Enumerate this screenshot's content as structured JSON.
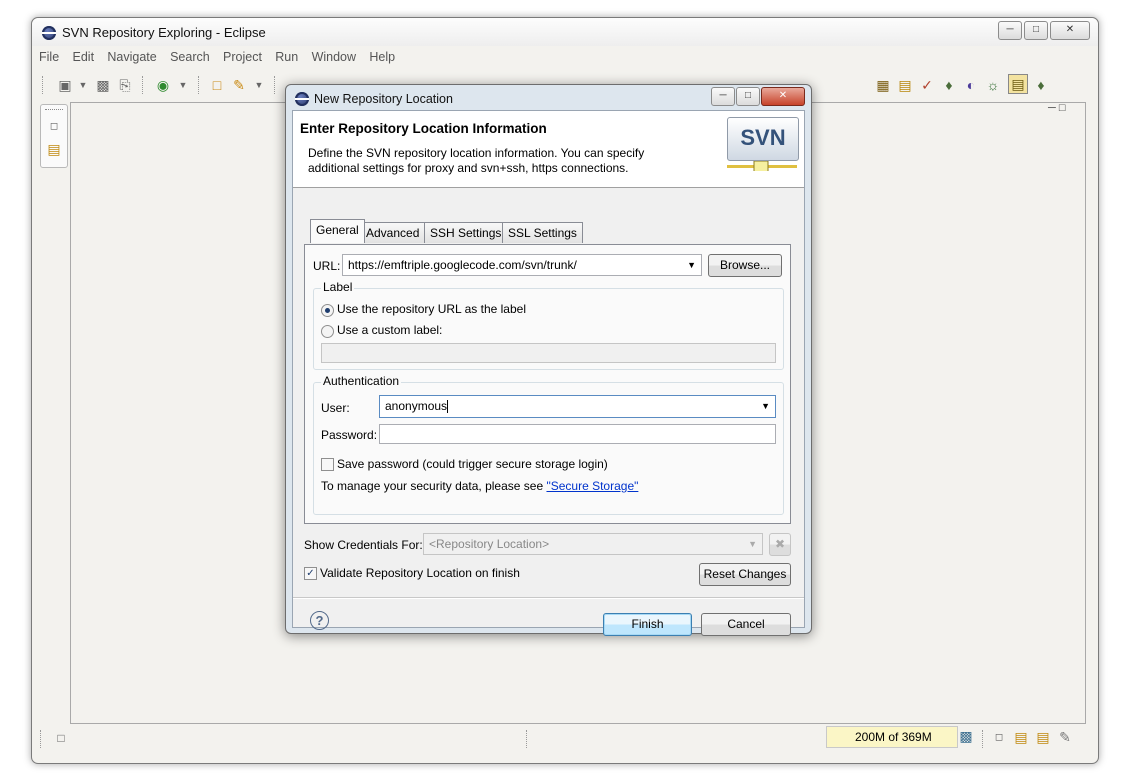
{
  "window": {
    "title": "SVN Repository Exploring - Eclipse",
    "minimize_icon": "minimize-icon",
    "maximize_icon": "maximize-icon",
    "close_icon": "close-icon"
  },
  "menubar": {
    "items": [
      {
        "label": "File"
      },
      {
        "label": "Edit"
      },
      {
        "label": "Navigate"
      },
      {
        "label": "Search"
      },
      {
        "label": "Project"
      },
      {
        "label": "Run"
      },
      {
        "label": "Window"
      },
      {
        "label": "Help"
      }
    ]
  },
  "statusbar": {
    "heap": "200M of 369M"
  },
  "dialog": {
    "title": "New Repository Location",
    "header": {
      "title": "Enter Repository Location Information",
      "description": "Define the SVN repository location information. You can specify additional settings for proxy and svn+ssh, https connections.",
      "logo_text": "SVN"
    },
    "tabs": [
      {
        "label": "General",
        "active": true
      },
      {
        "label": "Advanced"
      },
      {
        "label": "SSH Settings"
      },
      {
        "label": "SSL Settings"
      }
    ],
    "url": {
      "label": "URL:",
      "value": "https://emftriple.googlecode.com/svn/trunk/",
      "browse_label": "Browse..."
    },
    "label_group": {
      "title": "Label",
      "option_repo_url": "Use the repository URL as the label",
      "option_custom": "Use a custom label:",
      "custom_value": ""
    },
    "auth_group": {
      "title": "Authentication",
      "user_label": "User:",
      "user_value": "anonymous",
      "password_label": "Password:",
      "password_value": "",
      "save_password_label": "Save password (could trigger secure storage login)",
      "security_text": "To manage your security data, please see ",
      "security_link": "\"Secure Storage\""
    },
    "show_credentials": {
      "label": "Show Credentials For:",
      "value": "<Repository Location>"
    },
    "validate_label": "Validate Repository Location on finish",
    "reset_label": "Reset Changes",
    "finish_label": "Finish",
    "cancel_label": "Cancel",
    "help_icon": "help-icon"
  }
}
